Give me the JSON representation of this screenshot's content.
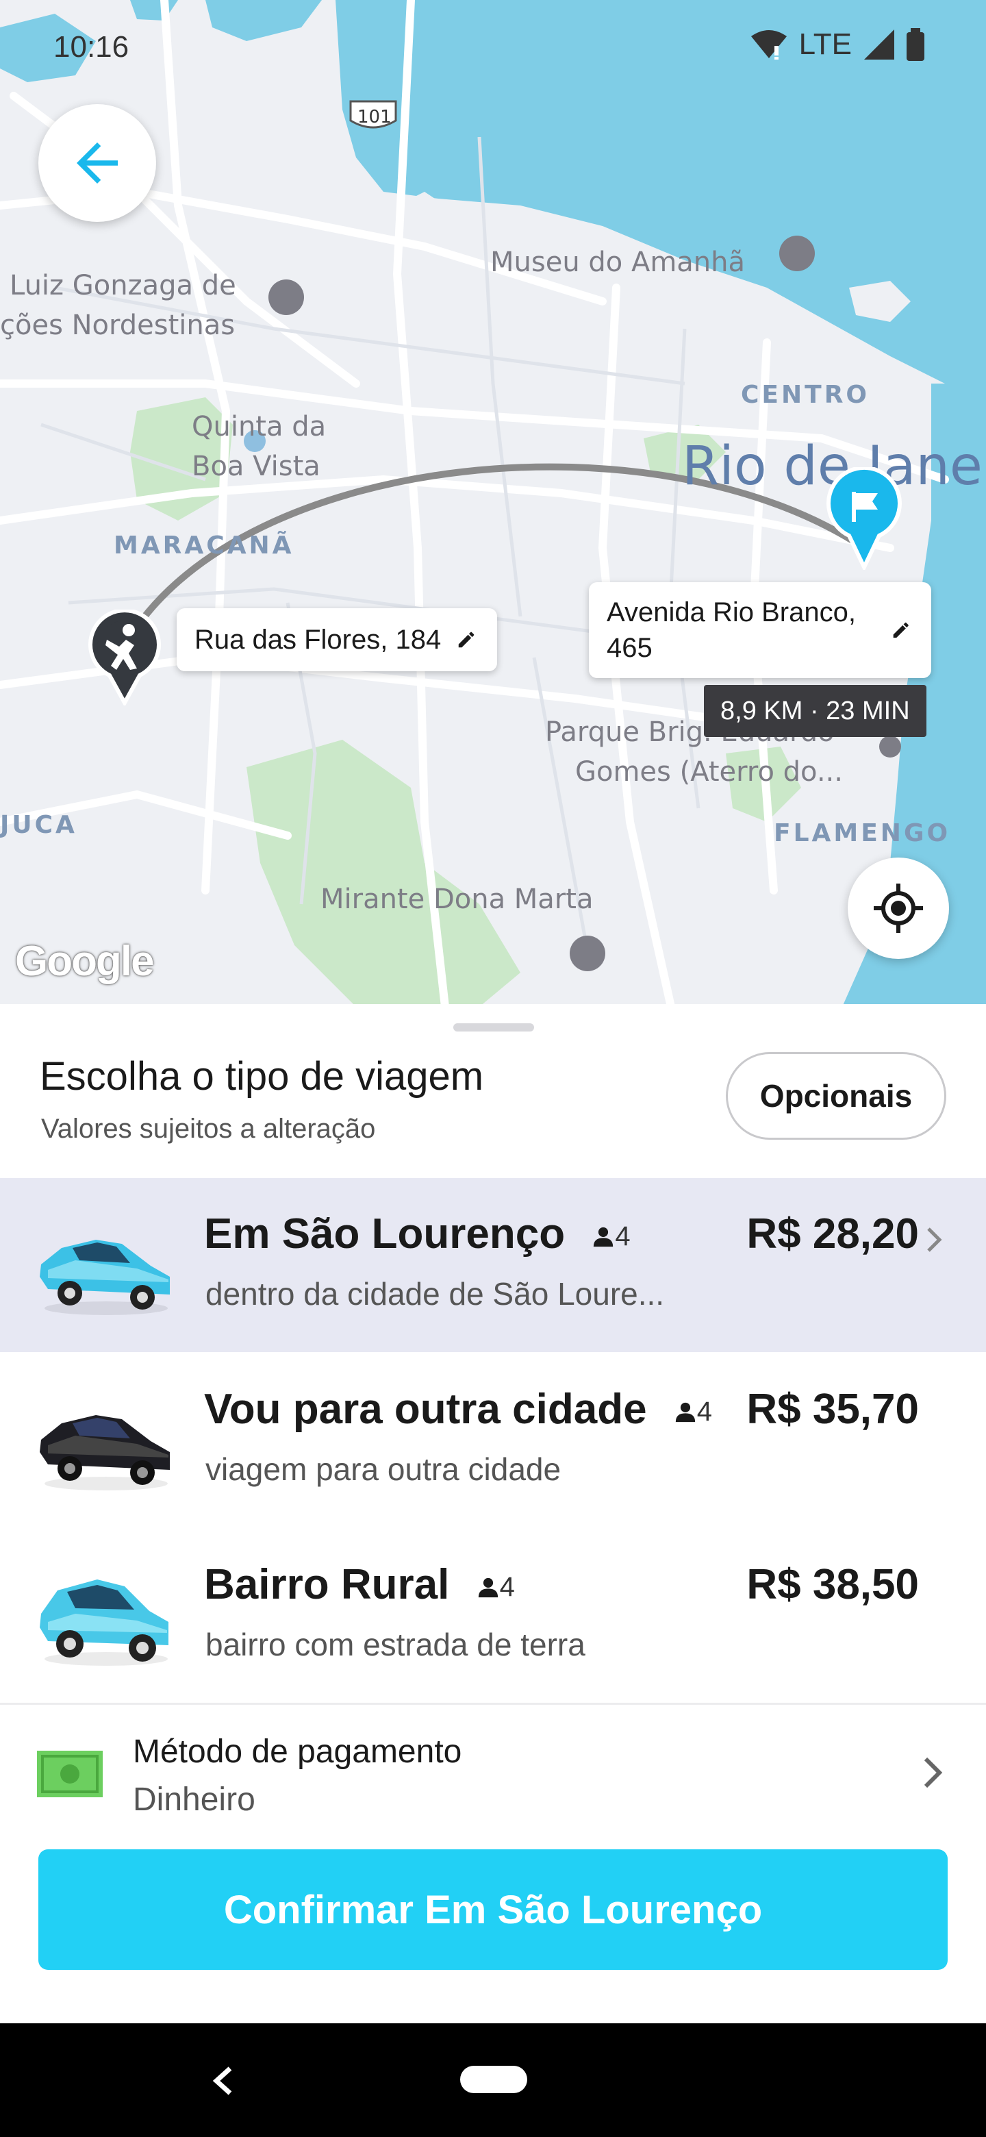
{
  "status_bar": {
    "time": "10:16",
    "network": "LTE"
  },
  "map": {
    "labels": {
      "highway": "101",
      "museum": "Museu do Amanhã",
      "luiz_1": "Luiz Gonzaga de",
      "luiz_2": "ções Nordestinas",
      "quinta_1": "Quinta da",
      "quinta_2": "Boa Vista",
      "maracana": "MARACANÃ",
      "centro": "CENTRO",
      "rio": "Rio de Jane",
      "parque_1": "Parque Brig. Eduardo",
      "parque_2": "Gomes (Aterro do...",
      "juca": "JUCA",
      "flamengo": "FLAMENGO",
      "mirante": "Mirante Dona Marta"
    },
    "origin_address": "Rua das Flores, 184",
    "destination_address": "Avenida Rio Branco, 465",
    "eta": "8,9 KM · 23 MIN",
    "logo": "Google",
    "colors": {
      "water": "#7fcde6",
      "land": "#eef0f4",
      "park": "#cbe8c9",
      "route": "#8a8a8a",
      "pin_blue": "#1ab8ec",
      "pin_dark": "#35393f"
    }
  },
  "sheet": {
    "title": "Escolha o tipo de viagem",
    "subtitle": "Valores sujeitos a alteração",
    "options_label": "Opcionais",
    "rides": [
      {
        "name": "Em São Lourenço",
        "passengers": "4",
        "description": "dentro da cidade de São Loure...",
        "price": "R$ 28,20",
        "selected": true,
        "car_color": "#3cc1e6"
      },
      {
        "name": "Vou para outra cidade",
        "passengers": "4",
        "description": "viagem para outra cidade",
        "price": "R$ 35,70",
        "selected": false,
        "car_color": "#1e1e24"
      },
      {
        "name": "Bairro Rural",
        "passengers": "4",
        "description": "bairro com estrada de terra",
        "price": "R$ 38,50",
        "selected": false,
        "car_color": "#48c8e8"
      }
    ],
    "payment": {
      "title": "Método de pagamento",
      "value": "Dinheiro"
    },
    "confirm_label": "Confirmar Em São Lourenço",
    "accent": "#22d0f5"
  }
}
